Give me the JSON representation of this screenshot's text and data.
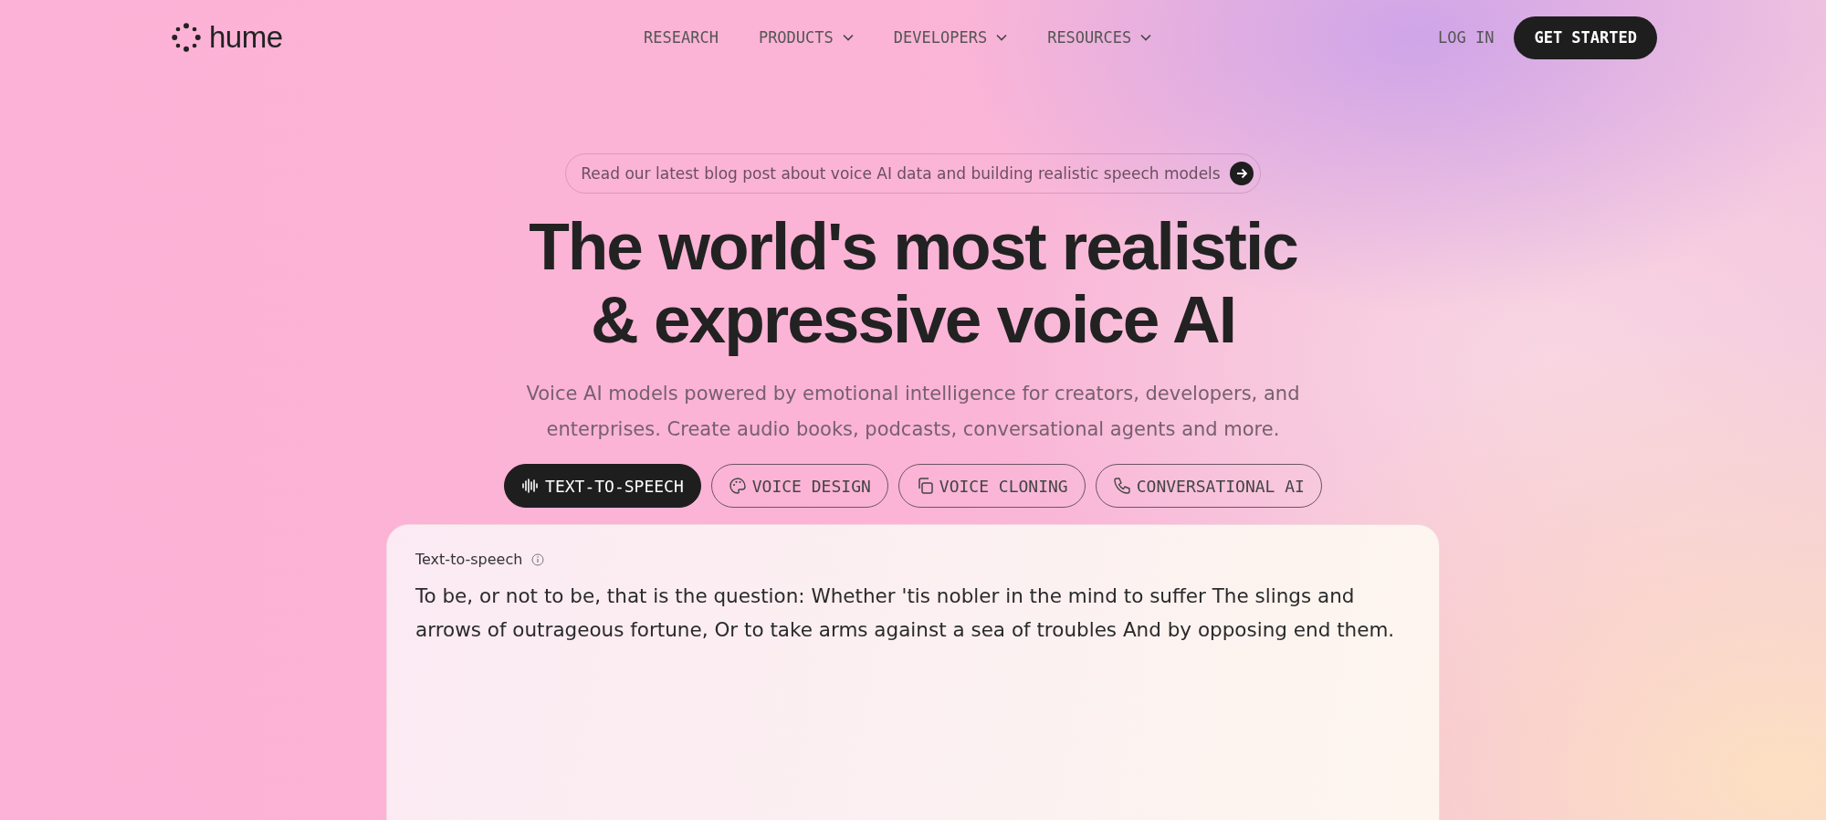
{
  "brand": {
    "name": "hume"
  },
  "nav": {
    "links": [
      {
        "label": "RESEARCH",
        "dropdown": false
      },
      {
        "label": "PRODUCTS",
        "dropdown": true
      },
      {
        "label": "DEVELOPERS",
        "dropdown": true
      },
      {
        "label": "RESOURCES",
        "dropdown": true
      }
    ],
    "login": "LOG IN",
    "cta": "GET STARTED"
  },
  "announcement": "Read our latest blog post about voice AI data and building realistic speech models",
  "headline": [
    "The world's most realistic",
    "& expressive voice AI"
  ],
  "subtitle": "Voice AI models powered by emotional intelligence for creators, developers, and enterprises. Create audio books, podcasts, conversational agents and more.",
  "tabs": [
    {
      "label": "TEXT-TO-SPEECH",
      "kind": "waveform",
      "selected": true
    },
    {
      "label": "VOICE DESIGN",
      "kind": "palette",
      "selected": false
    },
    {
      "label": "VOICE CLONING",
      "kind": "copy",
      "selected": false
    },
    {
      "label": "CONVERSATIONAL AI",
      "kind": "phone",
      "selected": false
    }
  ],
  "card": {
    "label": "Text-to-speech",
    "value": "To be, or not to be, that is the question: Whether 'tis nobler in the mind to suffer The slings and arrows of outrageous fortune, Or to take arms against a sea of troubles And by opposing end them."
  }
}
